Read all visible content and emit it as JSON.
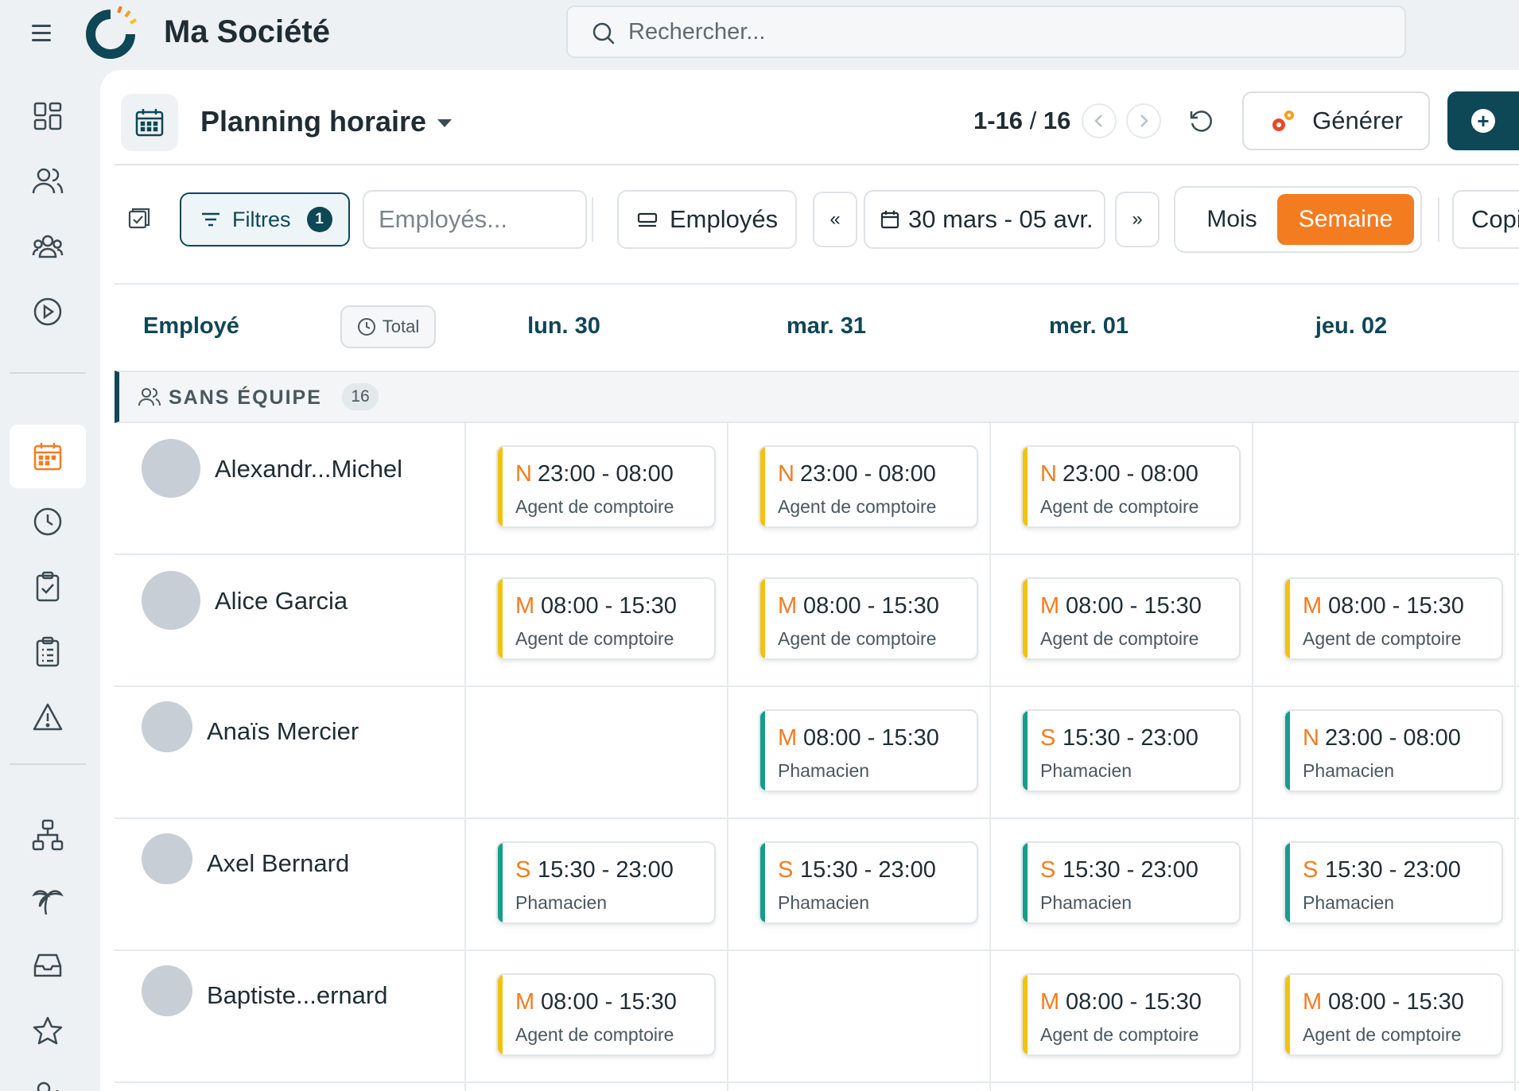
{
  "app": {
    "title": "Ma Société",
    "search_placeholder": "Rechercher..."
  },
  "colors": {
    "primary": "#0e4756",
    "accent": "#f47c20",
    "shift_bar_yellow": "#f4c20d",
    "shift_bar_teal": "#179c8c"
  },
  "sidebar": {
    "items": [
      {
        "icon": "dashboard-icon"
      },
      {
        "icon": "users-icon"
      },
      {
        "icon": "team-icon"
      },
      {
        "icon": "play-icon"
      },
      {
        "icon": "calendar-icon",
        "active": true
      },
      {
        "icon": "clock-icon"
      },
      {
        "icon": "clipboard-check-icon"
      },
      {
        "icon": "clipboard-list-icon"
      },
      {
        "icon": "warning-icon"
      },
      {
        "icon": "org-chart-icon"
      },
      {
        "icon": "palm-tree-icon"
      },
      {
        "icon": "inbox-icon"
      },
      {
        "icon": "star-icon"
      },
      {
        "icon": "user-add-icon"
      }
    ]
  },
  "header": {
    "title": "Planning horaire",
    "pager_range": "1-16",
    "pager_sep": " / ",
    "pager_total": "16",
    "generate_label": "Générer"
  },
  "toolbar": {
    "filters_label": "Filtres",
    "filters_count": "1",
    "employee_placeholder": "Employés...",
    "group_by_label": "Employés",
    "prev_label": "«",
    "next_label": "»",
    "date_range": "30 mars - 05 avr.",
    "view_month": "Mois",
    "view_week": "Semaine",
    "copy_label": "Copi"
  },
  "grid": {
    "employee_header": "Employé",
    "total_label": "Total",
    "days": [
      "lun. 30",
      "mar. 31",
      "mer. 01",
      "jeu. 02"
    ],
    "group": {
      "label": "SANS ÉQUIPE",
      "count": "16"
    },
    "rows": [
      {
        "name": "Alexandr...Michel",
        "shifts": [
          {
            "code": "N",
            "time": "23:00 - 08:00",
            "role": "Agent de comptoire",
            "color": "yellow"
          },
          {
            "code": "N",
            "time": "23:00 - 08:00",
            "role": "Agent de comptoire",
            "color": "yellow"
          },
          {
            "code": "N",
            "time": "23:00 - 08:00",
            "role": "Agent de comptoire",
            "color": "yellow"
          },
          null
        ]
      },
      {
        "name": "Alice Garcia",
        "shifts": [
          {
            "code": "M",
            "time": "08:00 - 15:30",
            "role": "Agent de comptoire",
            "color": "yellow"
          },
          {
            "code": "M",
            "time": "08:00 - 15:30",
            "role": "Agent de comptoire",
            "color": "yellow"
          },
          {
            "code": "M",
            "time": "08:00 - 15:30",
            "role": "Agent de comptoire",
            "color": "yellow"
          },
          {
            "code": "M",
            "time": "08:00 - 15:30",
            "role": "Agent de comptoire",
            "color": "yellow"
          }
        ]
      },
      {
        "name": "Anaïs Mercier",
        "shifts": [
          null,
          {
            "code": "M",
            "time": "08:00 - 15:30",
            "role": "Phamacien",
            "color": "teal"
          },
          {
            "code": "S",
            "time": "15:30 - 23:00",
            "role": "Phamacien",
            "color": "teal"
          },
          {
            "code": "N",
            "time": "23:00 - 08:00",
            "role": "Phamacien",
            "color": "teal"
          }
        ]
      },
      {
        "name": "Axel Bernard",
        "shifts": [
          {
            "code": "S",
            "time": "15:30 - 23:00",
            "role": "Phamacien",
            "color": "teal"
          },
          {
            "code": "S",
            "time": "15:30 - 23:00",
            "role": "Phamacien",
            "color": "teal"
          },
          {
            "code": "S",
            "time": "15:30 - 23:00",
            "role": "Phamacien",
            "color": "teal"
          },
          {
            "code": "S",
            "time": "15:30 - 23:00",
            "role": "Phamacien",
            "color": "teal"
          }
        ]
      },
      {
        "name": "Baptiste...ernard",
        "shifts": [
          {
            "code": "M",
            "time": "08:00 - 15:30",
            "role": "Agent de comptoire",
            "color": "yellow"
          },
          null,
          {
            "code": "M",
            "time": "08:00 - 15:30",
            "role": "Agent de comptoire",
            "color": "yellow"
          },
          {
            "code": "M",
            "time": "08:00 - 15:30",
            "role": "Agent de comptoire",
            "color": "yellow"
          }
        ]
      }
    ]
  }
}
